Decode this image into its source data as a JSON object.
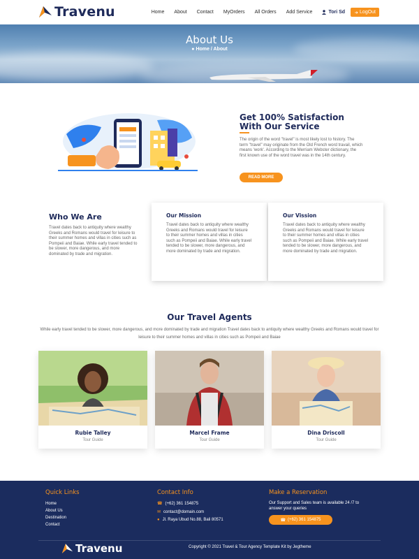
{
  "brand": {
    "name": "Travenu"
  },
  "nav": {
    "links": [
      "Home",
      "About",
      "Contact",
      "MyOrders",
      "All Orders",
      "Add Service"
    ],
    "user": "Tori Sd",
    "logout": "LogOut"
  },
  "hero": {
    "title": "About Us",
    "crumb_home": "Home",
    "crumb_sep": " / ",
    "crumb_current": "About"
  },
  "about": {
    "title_line1": "Get 100% Satisfaction",
    "title_line2": "With Our Service",
    "text": "The origin of the word \"travel\" is most likely lost to history. The term \"travel\" may originate from the Old French word travail, which means 'work'. According to the Merriam Webster dictionary, the first known use of the word travel was in the 14th century.",
    "button": "READ MORE"
  },
  "who": {
    "title": "Who We Are",
    "text": "Travel dates back to antiquity where wealthy Greeks and Romans would travel for leisure to their summer homes and villas in cities such as Pompeii and Baiae. While early travel tended to be slower, more dangerous, and more dominated by trade and migration."
  },
  "mission": {
    "title": "Our Mission",
    "text": "Travel dates back to antiquity where wealthy Greeks and Romans would travel for leisure to their summer homes and villas in cities such as Pompeii and Baiae. While early travel tended to be slower, more dangerous, and more dominated by trade and migration."
  },
  "vision": {
    "title": "Our Vission",
    "text": "Travel dates back to antiquity where wealthy Greeks and Romans would travel for leisure to their summer homes and villas in cities such as Pompeii and Baiae. While early travel tended to be slower, more dangerous, and more dominated by trade and migration."
  },
  "agents": {
    "title": "Our Travel Agents",
    "desc": "While early travel tended to be slower, more dangerous, and more dominated by trade and migration Travel dates back to antiquity where wealthy Greeks and Romans would travel for leisure to their summer homes and villas in cities such as Pompeii and Baiae",
    "list": [
      {
        "name": "Rubie Talley",
        "role": "Tour Guide"
      },
      {
        "name": "Marcel Frame",
        "role": "Tour Guide"
      },
      {
        "name": "Dina Driscoll",
        "role": "Tour Guide"
      }
    ]
  },
  "footer": {
    "quick_links_title": "Quick Links",
    "quick_links": [
      "Home",
      "About Us",
      "Destination",
      "Contact"
    ],
    "contact_title": "Contact Info",
    "phone": "(+62) 361 154875",
    "email": "contact@domain.com",
    "address": "Jl. Raya Ubud No.88, Bali 80571",
    "reservation_title": "Make a Reservation",
    "reservation_text": "Our Support and Sales team is available 24 /7 to answer your queries",
    "reservation_phone": "(+62) 361 154875",
    "copyright": "Copyright © 2021 Travel & Tour Agency Template Kit by Jegtheme"
  },
  "colors": {
    "navy": "#1e2a5a",
    "orange": "#f7931e",
    "footer": "#1b2c5e"
  }
}
